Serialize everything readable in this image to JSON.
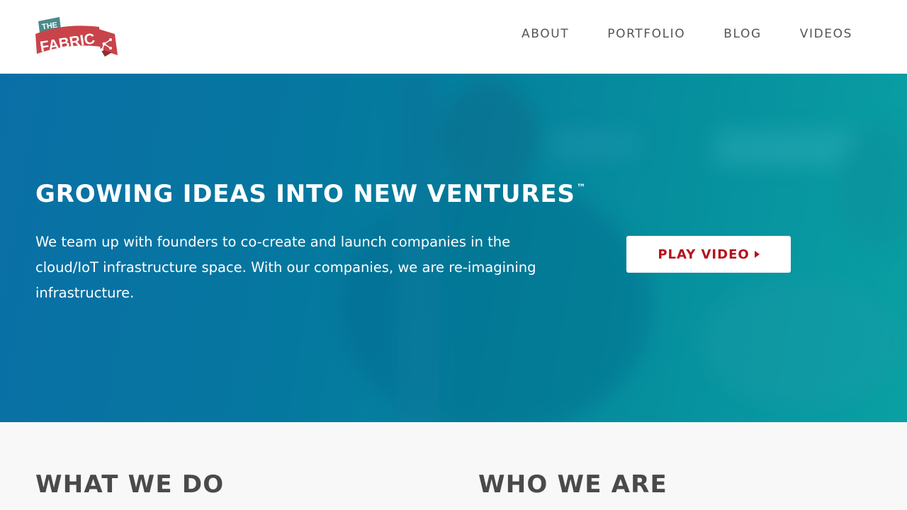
{
  "brand": {
    "logo_text_top": "THE",
    "logo_text_main": "FABRIC",
    "logo_colors": {
      "banner_red": "#c8444a",
      "banner_teal": "#4a8a8a"
    }
  },
  "nav": {
    "items": [
      {
        "label": "ABOUT"
      },
      {
        "label": "PORTFOLIO"
      },
      {
        "label": "BLOG"
      },
      {
        "label": "VIDEOS"
      }
    ]
  },
  "hero": {
    "title": "GROWING IDEAS INTO NEW VENTURES",
    "trademark": "™",
    "body": "We team up with founders to co-create and launch companies in the cloud/IoT infrastructure space. With our companies, we are re-imagining infrastructure.",
    "cta_label": "PLAY VIDEO",
    "cta_icon": "play-triangle-icon",
    "gradient_colors": [
      "#0a6fa6",
      "#0aa0a3"
    ]
  },
  "sections": {
    "left_heading": "WHAT WE DO",
    "right_heading": "WHO WE ARE"
  },
  "colors": {
    "cta_text": "#b5121b",
    "nav_text": "#555555",
    "heading_text": "#4a4a4a",
    "lower_bg": "#f8f8f8"
  }
}
